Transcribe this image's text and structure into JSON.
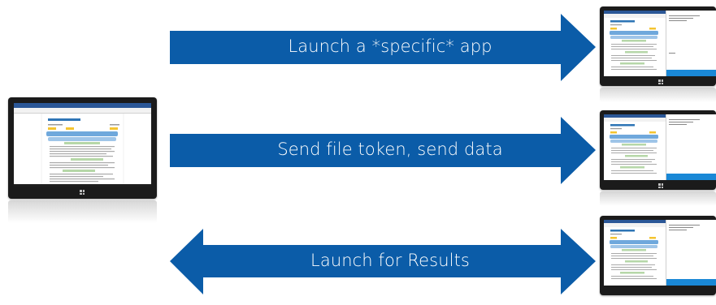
{
  "arrows": [
    {
      "label": "Launch a *specific* app",
      "direction": "right"
    },
    {
      "label": "Send file token, send data",
      "direction": "right"
    },
    {
      "label": "Launch for Results",
      "direction": "both"
    }
  ],
  "devices": {
    "source": {
      "screen_title": "Worldwide Activities",
      "icon": "tablet-icon"
    },
    "targets": [
      {
        "icon": "tablet-icon",
        "panel_color": "#1a88d6"
      },
      {
        "icon": "tablet-icon",
        "panel_color": "#1a88d6"
      },
      {
        "icon": "tablet-icon",
        "panel_color": "#1a88d6"
      }
    ]
  },
  "colors": {
    "arrow": "#0b5ca8",
    "arrow_text": "#ffffff",
    "tablet_bezel": "#1b1b1b",
    "accent": "#1a88d6"
  }
}
